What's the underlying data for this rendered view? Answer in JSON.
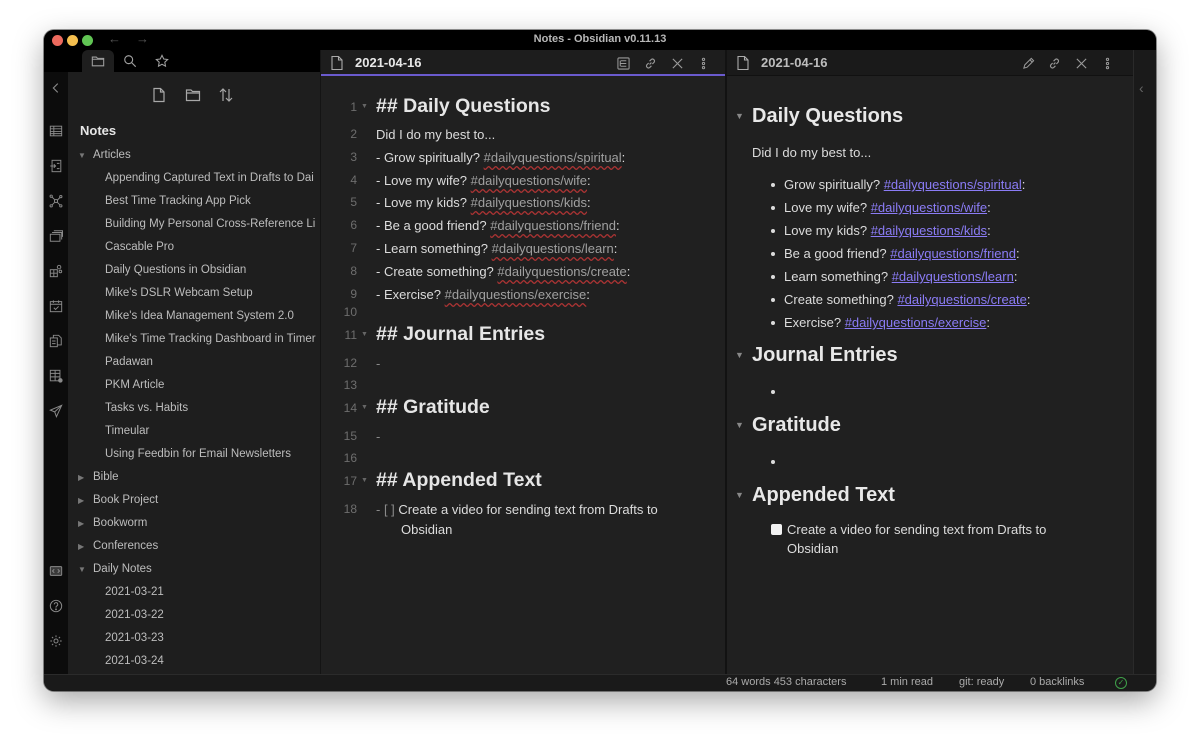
{
  "window": {
    "title": "Notes - Obsidian v0.11.13",
    "back_icon": "arrow-left-icon",
    "forward_icon": "arrow-right-icon"
  },
  "ribbon": {
    "top_icons": [
      "collapse-left-icon",
      "table-icon",
      "import-icon",
      "graph-view-icon",
      "cards-icon",
      "grid-plugin-icon",
      "calendar-icon",
      "copy-icon",
      "kanban-icon",
      "send-icon"
    ],
    "bottom_icons": [
      "vault-switch-icon",
      "help-icon",
      "settings-icon"
    ]
  },
  "sidebar": {
    "tabs": [
      {
        "name": "file-explorer",
        "icon": "folder-icon",
        "active": true
      },
      {
        "name": "search",
        "icon": "search-icon",
        "active": false
      },
      {
        "name": "starred",
        "icon": "star-icon",
        "active": false
      }
    ],
    "actions": [
      "new-note-icon",
      "new-folder-icon",
      "sort-icon"
    ],
    "vault_name": "Notes",
    "tree": [
      {
        "type": "folder",
        "label": "Articles",
        "expanded": true
      },
      {
        "type": "file",
        "label": "Appending Captured Text in Drafts to Dai"
      },
      {
        "type": "file",
        "label": "Best Time Tracking App Pick"
      },
      {
        "type": "file",
        "label": "Building My Personal Cross-Reference Li"
      },
      {
        "type": "file",
        "label": "Cascable Pro"
      },
      {
        "type": "file",
        "label": "Daily Questions in Obsidian"
      },
      {
        "type": "file",
        "label": "Mike's DSLR Webcam Setup"
      },
      {
        "type": "file",
        "label": "Mike's Idea Management System 2.0"
      },
      {
        "type": "file",
        "label": "Mike's Time Tracking Dashboard in Timer"
      },
      {
        "type": "file",
        "label": "Padawan"
      },
      {
        "type": "file",
        "label": "PKM Article"
      },
      {
        "type": "file",
        "label": "Tasks vs. Habits"
      },
      {
        "type": "file",
        "label": "Timeular"
      },
      {
        "type": "file",
        "label": "Using Feedbin for Email Newsletters"
      },
      {
        "type": "folder",
        "label": "Bible",
        "expanded": false
      },
      {
        "type": "folder",
        "label": "Book Project",
        "expanded": false
      },
      {
        "type": "folder",
        "label": "Bookworm",
        "expanded": false
      },
      {
        "type": "folder",
        "label": "Conferences",
        "expanded": false
      },
      {
        "type": "folder",
        "label": "Daily Notes",
        "expanded": true
      },
      {
        "type": "file",
        "label": "2021-03-21"
      },
      {
        "type": "file",
        "label": "2021-03-22"
      },
      {
        "type": "file",
        "label": "2021-03-23"
      },
      {
        "type": "file",
        "label": "2021-03-24"
      }
    ]
  },
  "editor": {
    "title": "2021-04-16",
    "actions": [
      "preview-toggle-icon",
      "link-icon",
      "close-icon",
      "more-options-icon"
    ],
    "lines": [
      {
        "n": "1",
        "fold": true,
        "kind": "h2",
        "text": "## Daily Questions"
      },
      {
        "n": "2",
        "kind": "text",
        "text": "Did I do my best to..."
      },
      {
        "n": "3",
        "kind": "item",
        "prefix": "- Grow spiritually? ",
        "tag": "#dailyquestions/spiritual",
        "suffix": ":"
      },
      {
        "n": "4",
        "kind": "item",
        "prefix": "- Love my wife? ",
        "tag": "#dailyquestions/wife",
        "suffix": ":"
      },
      {
        "n": "5",
        "kind": "item",
        "prefix": "- Love my kids? ",
        "tag": "#dailyquestions/kids",
        "suffix": ":"
      },
      {
        "n": "6",
        "kind": "item",
        "prefix": "- Be a good friend? ",
        "tag": "#dailyquestions/friend",
        "suffix": ":"
      },
      {
        "n": "7",
        "kind": "item",
        "prefix": "- Learn something? ",
        "tag": "#dailyquestions/learn",
        "suffix": ":"
      },
      {
        "n": "8",
        "kind": "item",
        "prefix": "- Create something? ",
        "tag": "#dailyquestions/create",
        "suffix": ":"
      },
      {
        "n": "9",
        "kind": "item",
        "prefix": "- Exercise? ",
        "tag": "#dailyquestions/exercise",
        "suffix": ":"
      },
      {
        "n": "10",
        "kind": "blank",
        "text": ""
      },
      {
        "n": "11",
        "fold": true,
        "kind": "h2",
        "text": "## Journal Entries"
      },
      {
        "n": "12",
        "kind": "dash",
        "text": "-"
      },
      {
        "n": "13",
        "kind": "blank",
        "text": ""
      },
      {
        "n": "14",
        "fold": true,
        "kind": "h2",
        "text": "## Gratitude"
      },
      {
        "n": "15",
        "kind": "dash",
        "text": "-"
      },
      {
        "n": "16",
        "kind": "blank",
        "text": ""
      },
      {
        "n": "17",
        "fold": true,
        "kind": "h2",
        "text": "## Appended Text"
      },
      {
        "n": "18",
        "kind": "task",
        "prefix": "- [ ] ",
        "text": "Create a video for sending text from Drafts to",
        "text2": "Obsidian"
      }
    ]
  },
  "preview": {
    "title": "2021-04-16",
    "actions": [
      "edit-pencil-icon",
      "link-icon",
      "close-icon",
      "more-options-icon"
    ],
    "sections": [
      {
        "heading": "Daily Questions",
        "intro": "Did I do my best to...",
        "items": [
          {
            "text": "Grow spiritually? ",
            "tag": "#dailyquestions/spiritual",
            "suffix": ":"
          },
          {
            "text": "Love my wife? ",
            "tag": "#dailyquestions/wife",
            "suffix": ":"
          },
          {
            "text": "Love my kids? ",
            "tag": "#dailyquestions/kids",
            "suffix": ":"
          },
          {
            "text": "Be a good friend? ",
            "tag": "#dailyquestions/friend",
            "suffix": ":"
          },
          {
            "text": "Learn something? ",
            "tag": "#dailyquestions/learn",
            "suffix": ":"
          },
          {
            "text": "Create something? ",
            "tag": "#dailyquestions/create",
            "suffix": ":"
          },
          {
            "text": "Exercise? ",
            "tag": "#dailyquestions/exercise",
            "suffix": ":"
          }
        ]
      },
      {
        "heading": "Journal Entries",
        "items": [
          {
            "text": ""
          }
        ]
      },
      {
        "heading": "Gratitude",
        "items": [
          {
            "text": ""
          }
        ]
      },
      {
        "heading": "Appended Text",
        "task": {
          "checked": false,
          "text": "Create a video for sending text from Drafts to",
          "text2": "Obsidian"
        }
      }
    ]
  },
  "status": {
    "word_count": "64 words 453 characters",
    "read_time": "1 min read",
    "git": "git: ready",
    "backlinks": "0 backlinks",
    "sync_icon": "sync-ok-check-icon"
  },
  "colors": {
    "accent": "#6a5acd",
    "tag_link": "#8b7cf6",
    "sync_ok": "#3fa04a"
  }
}
